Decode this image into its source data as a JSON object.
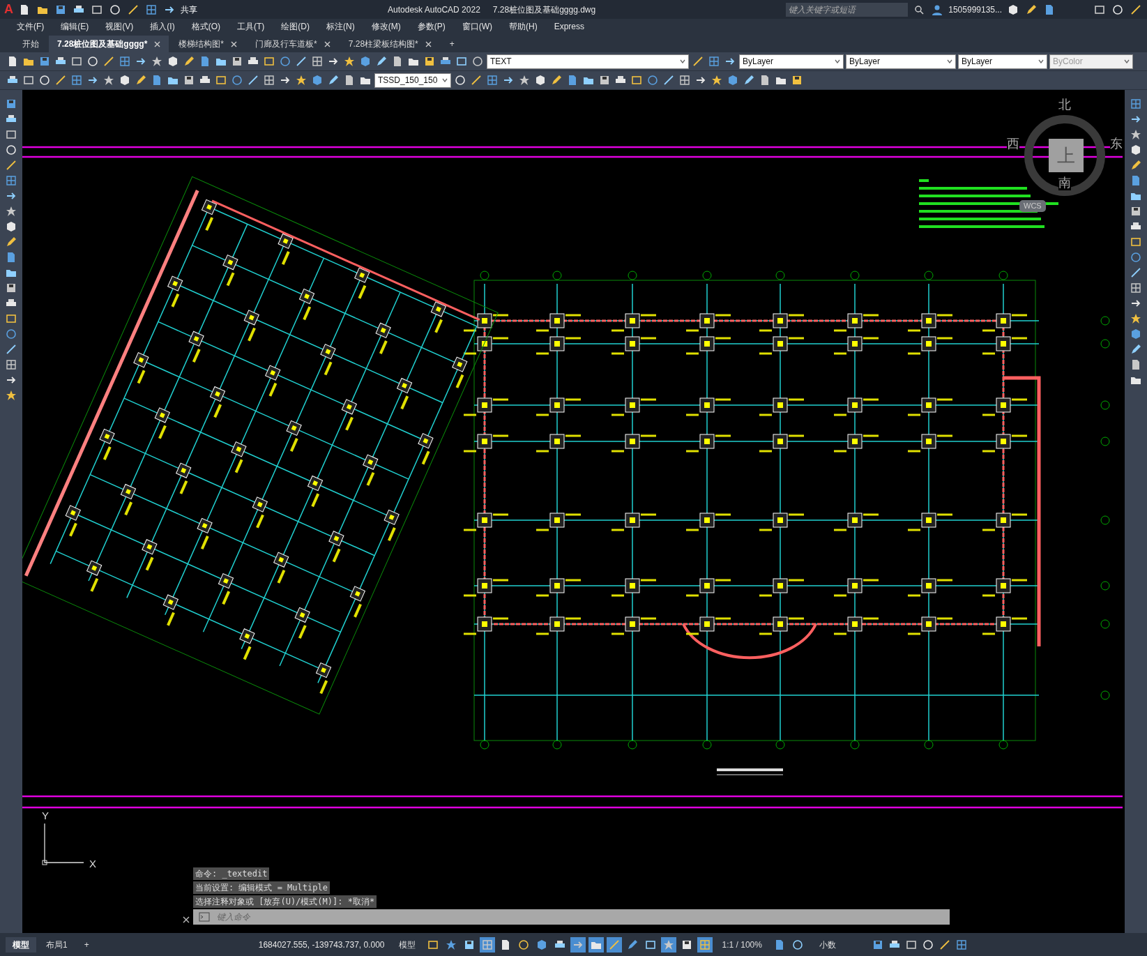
{
  "logo": "A",
  "quick_access": {
    "share": "共享"
  },
  "window": {
    "app": "Autodesk AutoCAD 2022",
    "file": "7.28桩位图及基础gggg.dwg"
  },
  "search": {
    "placeholder": "键入关键字或短语"
  },
  "user": {
    "name": "1505999135..."
  },
  "menu": [
    "文件(F)",
    "编辑(E)",
    "视图(V)",
    "插入(I)",
    "格式(O)",
    "工具(T)",
    "绘图(D)",
    "标注(N)",
    "修改(M)",
    "参数(P)",
    "窗口(W)",
    "帮助(H)",
    "Express"
  ],
  "tabs": [
    {
      "label": "开始",
      "selected": false,
      "closable": false
    },
    {
      "label": "7.28桩位图及基础gggg*",
      "selected": true,
      "closable": true
    },
    {
      "label": "楼梯结构图*",
      "selected": false,
      "closable": true
    },
    {
      "label": "门廊及行车道板*",
      "selected": false,
      "closable": true
    },
    {
      "label": "7.28柱梁板结构图*",
      "selected": false,
      "closable": true
    }
  ],
  "new_tab": "+",
  "properties": {
    "layer": "TEXT",
    "color_setting": "ByLayer",
    "linetype": "ByLayer",
    "lineweight": "ByLayer",
    "plotstyle": "ByColor",
    "plotstyle_disabled": true
  },
  "dimstyle": "TSSD_150_150",
  "viewcube": {
    "north": "北",
    "south": "南",
    "east": "东",
    "west": "西",
    "top": "上",
    "wcs": "WCS"
  },
  "ucs": {
    "y": "Y",
    "x": "X"
  },
  "command": {
    "history": [
      "命令: _textedit",
      "当前设置: 编辑模式 = Multiple",
      "选择注释对象或 [放弃(U)/模式(M)]: *取消*"
    ],
    "placeholder": "键入命令"
  },
  "layout_tabs": [
    {
      "label": "模型",
      "selected": true
    },
    {
      "label": "布局1",
      "selected": false
    }
  ],
  "new_layout": "+",
  "status": {
    "coordinates": "1684027.555, -139743.737, 0.000",
    "space": "模型",
    "scale": "1:1 / 100%",
    "units": "小数"
  },
  "status_toggles": [
    {
      "on": false
    },
    {
      "on": false
    },
    {
      "on": false
    },
    {
      "on": true
    },
    {
      "on": false
    },
    {
      "on": false
    },
    {
      "on": false
    },
    {
      "on": false
    },
    {
      "on": true
    },
    {
      "on": true
    },
    {
      "on": true
    },
    {
      "on": false
    },
    {
      "on": false
    },
    {
      "on": true
    },
    {
      "on": false
    },
    {
      "on": true
    },
    {
      "on": false
    },
    {
      "on": false
    }
  ]
}
